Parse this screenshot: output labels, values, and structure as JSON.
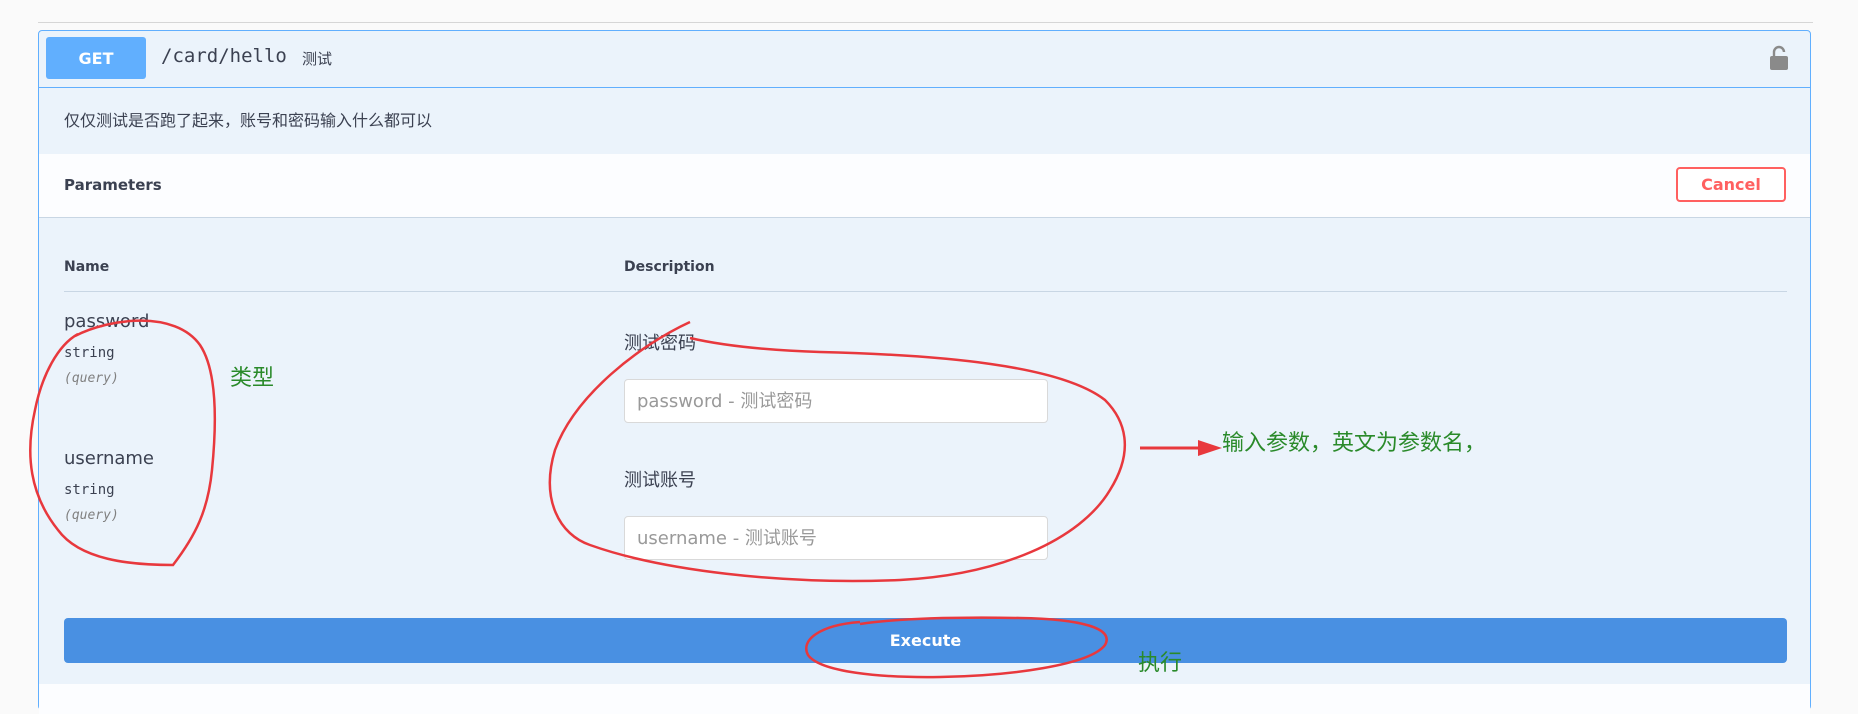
{
  "operation": {
    "method": "GET",
    "path": "/card/hello",
    "summary": "测试",
    "description": "仅仅测试是否跑了起来，账号和密码输入什么都可以"
  },
  "parameters": {
    "title": "Parameters",
    "cancel_label": "Cancel",
    "col_name": "Name",
    "col_description": "Description",
    "items": [
      {
        "name": "password",
        "type": "string",
        "in": "(query)",
        "description": "测试密码",
        "placeholder": "password - 测试密码"
      },
      {
        "name": "username",
        "type": "string",
        "in": "(query)",
        "description": "测试账号",
        "placeholder": "username - 测试账号"
      }
    ]
  },
  "execute_label": "Execute",
  "annotations": {
    "type_note": "类型",
    "input_note": "输入参数，英文为参数名，",
    "execute_note": "执行",
    "color": "#2a8a2a",
    "stroke_color": "#e8383d"
  },
  "colors": {
    "get_method": "#61affe",
    "execute": "#4990e2",
    "cancel": "#ff6060"
  }
}
